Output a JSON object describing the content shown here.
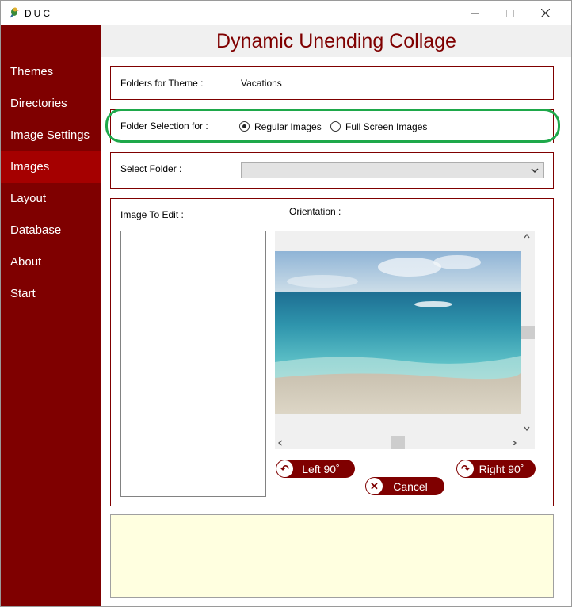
{
  "window": {
    "title": "DUC"
  },
  "header": {
    "title": "Dynamic Unending Collage"
  },
  "sidebar": {
    "items": [
      {
        "label": "Themes"
      },
      {
        "label": "Directories"
      },
      {
        "label": "Image Settings"
      },
      {
        "label": "Images",
        "active": true
      },
      {
        "label": "Layout"
      },
      {
        "label": "Database"
      },
      {
        "label": "About"
      },
      {
        "label": "Start"
      }
    ]
  },
  "theme_folders": {
    "label": "Folders for Theme :",
    "value": "Vacations"
  },
  "folder_selection": {
    "label": "Folder Selection for :",
    "options": [
      {
        "label": "Regular Images",
        "selected": true
      },
      {
        "label": "Full Screen Images",
        "selected": false
      }
    ]
  },
  "select_folder": {
    "label": "Select Folder :",
    "value": ""
  },
  "editor": {
    "image_label": "Image To Edit :",
    "orientation_label": "Orientation :",
    "left_button": "Left 90˚",
    "right_button": "Right 90˚",
    "cancel_button": "Cancel"
  },
  "colors": {
    "brand": "#7f0000",
    "active_nav": "#a50000",
    "highlight": "#1ea84a",
    "message_bg": "#ffffe0"
  },
  "icons": {
    "app": "parrot-icon",
    "left": "rotate-left-icon",
    "right": "rotate-right-icon",
    "cancel": "close-circle-icon"
  }
}
